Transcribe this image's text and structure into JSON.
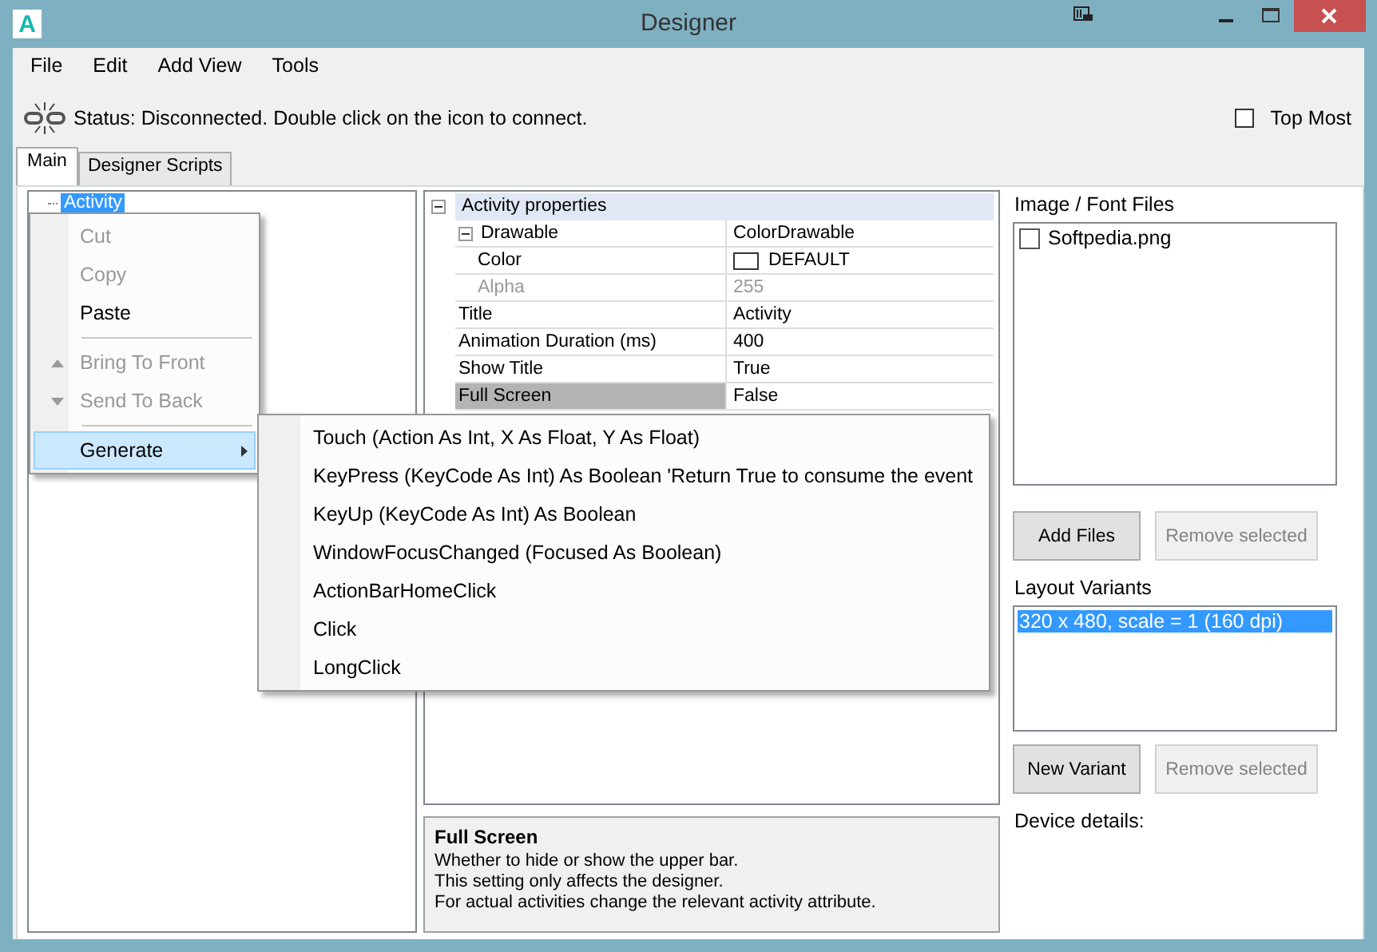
{
  "window": {
    "app_icon": "A",
    "title": "Designer"
  },
  "menu": [
    "File",
    "Edit",
    "Add View",
    "Tools"
  ],
  "status": {
    "text": "Status: Disconnected. Double click on the icon to connect.",
    "connected": false
  },
  "top_most": {
    "label": "Top Most",
    "checked": false
  },
  "tabs": [
    {
      "label": "Main",
      "selected": true
    },
    {
      "label": "Designer Scripts",
      "selected": false
    }
  ],
  "tree": [
    {
      "label": "Activity",
      "selected": true
    }
  ],
  "context_menu": [
    {
      "kind": "item",
      "label": "Cut",
      "disabled": true,
      "selected": false
    },
    {
      "kind": "item",
      "label": "Copy",
      "disabled": true,
      "selected": false
    },
    {
      "kind": "item",
      "label": "Paste",
      "disabled": false,
      "selected": false
    },
    {
      "kind": "separator"
    },
    {
      "kind": "move_up",
      "label": "Bring To Front",
      "disabled": true,
      "selected": false
    },
    {
      "kind": "move_down",
      "label": "Send To Back",
      "disabled": true,
      "selected": false
    },
    {
      "kind": "separator"
    },
    {
      "kind": "submenu",
      "label": "Generate",
      "disabled": false,
      "selected": true
    }
  ],
  "submenu": [
    "Touch (Action As Int, X As Float, Y As Float)",
    "KeyPress (KeyCode As Int) As Boolean 'Return True to consume the event",
    "KeyUp (KeyCode As Int) As Boolean",
    "WindowFocusChanged (Focused As Boolean)",
    "ActionBarHomeClick",
    "Click",
    "LongClick"
  ],
  "properties": {
    "label": "Activity properties",
    "expanded": true,
    "children": [
      {
        "name": "Drawable",
        "value": "ColorDrawable",
        "expanded": true,
        "selected": false,
        "disabled": false,
        "children": [
          {
            "kind": "color",
            "name": "Color",
            "value": "DEFAULT",
            "selected": false,
            "disabled": false
          },
          {
            "name": "Alpha",
            "value": "255",
            "selected": false,
            "disabled": true
          }
        ]
      },
      {
        "name": "Title",
        "value": "Activity",
        "selected": false,
        "disabled": false
      },
      {
        "name": "Animation Duration (ms)",
        "value": "400",
        "selected": false,
        "disabled": false
      },
      {
        "name": "Show Title",
        "value": "True",
        "selected": false,
        "disabled": false
      },
      {
        "name": "Full Screen",
        "value": "False",
        "selected": true,
        "disabled": false
      }
    ]
  },
  "description": {
    "title": "Full Screen",
    "lines": [
      "Whether to hide or show the upper bar.",
      "This setting only affects the designer.",
      "For actual activities change the relevant activity attribute."
    ]
  },
  "files": {
    "label": "Image / Font Files",
    "items": [
      {
        "label": "Softpedia.png",
        "checked": false
      }
    ],
    "buttons": [
      {
        "label": "Add Files",
        "disabled": false
      },
      {
        "label": "Remove selected",
        "disabled": true
      }
    ]
  },
  "variants": {
    "label": "Layout Variants",
    "items": [
      {
        "label": "320 x 480, scale = 1 (160 dpi)",
        "selected": true
      }
    ],
    "buttons": [
      {
        "label": "New Variant",
        "disabled": false
      },
      {
        "label": "Remove selected",
        "disabled": true
      }
    ]
  },
  "device_details": {
    "label": "Device details:"
  }
}
